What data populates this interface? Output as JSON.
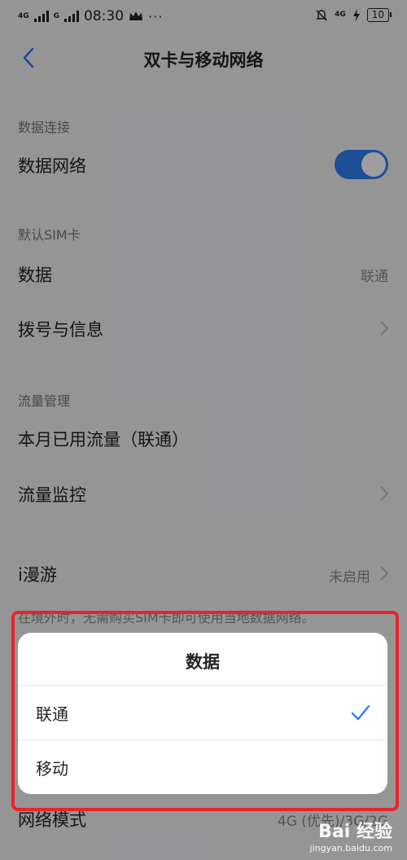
{
  "status_bar": {
    "time": "08:30",
    "sim1_label": "4G",
    "sim2_label": "G",
    "right_net_label": "4G",
    "battery": "10",
    "overflow": "···"
  },
  "header": {
    "title": "双卡与移动网络"
  },
  "data_connection": {
    "section": "数据连接",
    "mobile_data_label": "数据网络",
    "mobile_data_enabled": true
  },
  "default_sim": {
    "section": "默认SIM卡",
    "data_label": "数据",
    "data_value": "联通",
    "call_sms_label": "拨号与信息"
  },
  "traffic": {
    "section": "流量管理",
    "monthly_usage_label": "本月已用流量（联通）",
    "monitor_label": "流量监控"
  },
  "roaming": {
    "label": "i漫游",
    "value": "未启用",
    "description": "在境外时，无需购买SIM卡即可使用当地数据网络。"
  },
  "network_mode": {
    "label": "网络模式",
    "value": "4G (优先)/3G/2G"
  },
  "dialog": {
    "title": "数据",
    "options": [
      {
        "label": "联通",
        "selected": true
      },
      {
        "label": "移动",
        "selected": false
      }
    ]
  },
  "watermark": {
    "main": "Bai 经验",
    "sub": "jingyan.baidu.com"
  },
  "colors": {
    "accent": "#2f7ff5",
    "highlight": "#e8242b"
  }
}
